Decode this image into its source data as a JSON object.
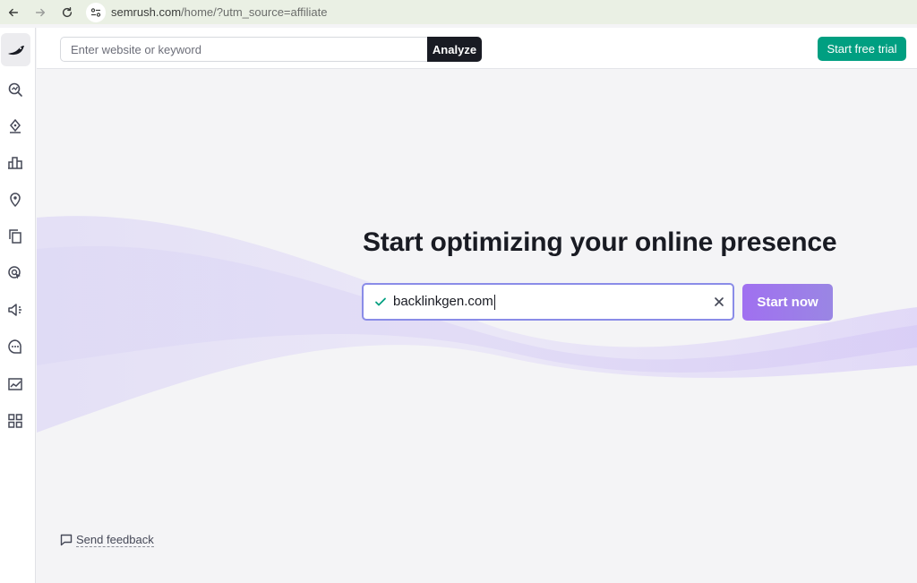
{
  "browser": {
    "url_host": "semrush.com",
    "url_path": "/home/?utm_source=affiliate",
    "back_icon": "arrow-left-icon",
    "forward_icon": "arrow-right-icon",
    "reload_icon": "reload-icon",
    "site_info_icon": "site-settings-icon"
  },
  "sidebar": {
    "logo_icon": "semrush-logo-icon",
    "items": [
      {
        "icon": "seo-magnifier-icon"
      },
      {
        "icon": "content-pen-icon"
      },
      {
        "icon": "bar-chart-icon"
      },
      {
        "icon": "local-pin-icon"
      },
      {
        "icon": "copy-pages-icon"
      },
      {
        "icon": "cursor-target-icon"
      },
      {
        "icon": "megaphone-icon"
      },
      {
        "icon": "chat-bubble-icon"
      },
      {
        "icon": "trend-chart-icon"
      },
      {
        "icon": "apps-grid-icon"
      }
    ]
  },
  "topbar": {
    "search_placeholder": "Enter website or keyword",
    "analyze_label": "Analyze",
    "trial_label": "Start free trial"
  },
  "hero": {
    "title": "Start optimizing your online presence",
    "input_value": "backlinkgen.com",
    "start_label": "Start now"
  },
  "footer": {
    "feedback_label": "Send feedback"
  },
  "colors": {
    "accent_green": "#009f81",
    "accent_purple": "#a070f0",
    "dark": "#191b23"
  }
}
